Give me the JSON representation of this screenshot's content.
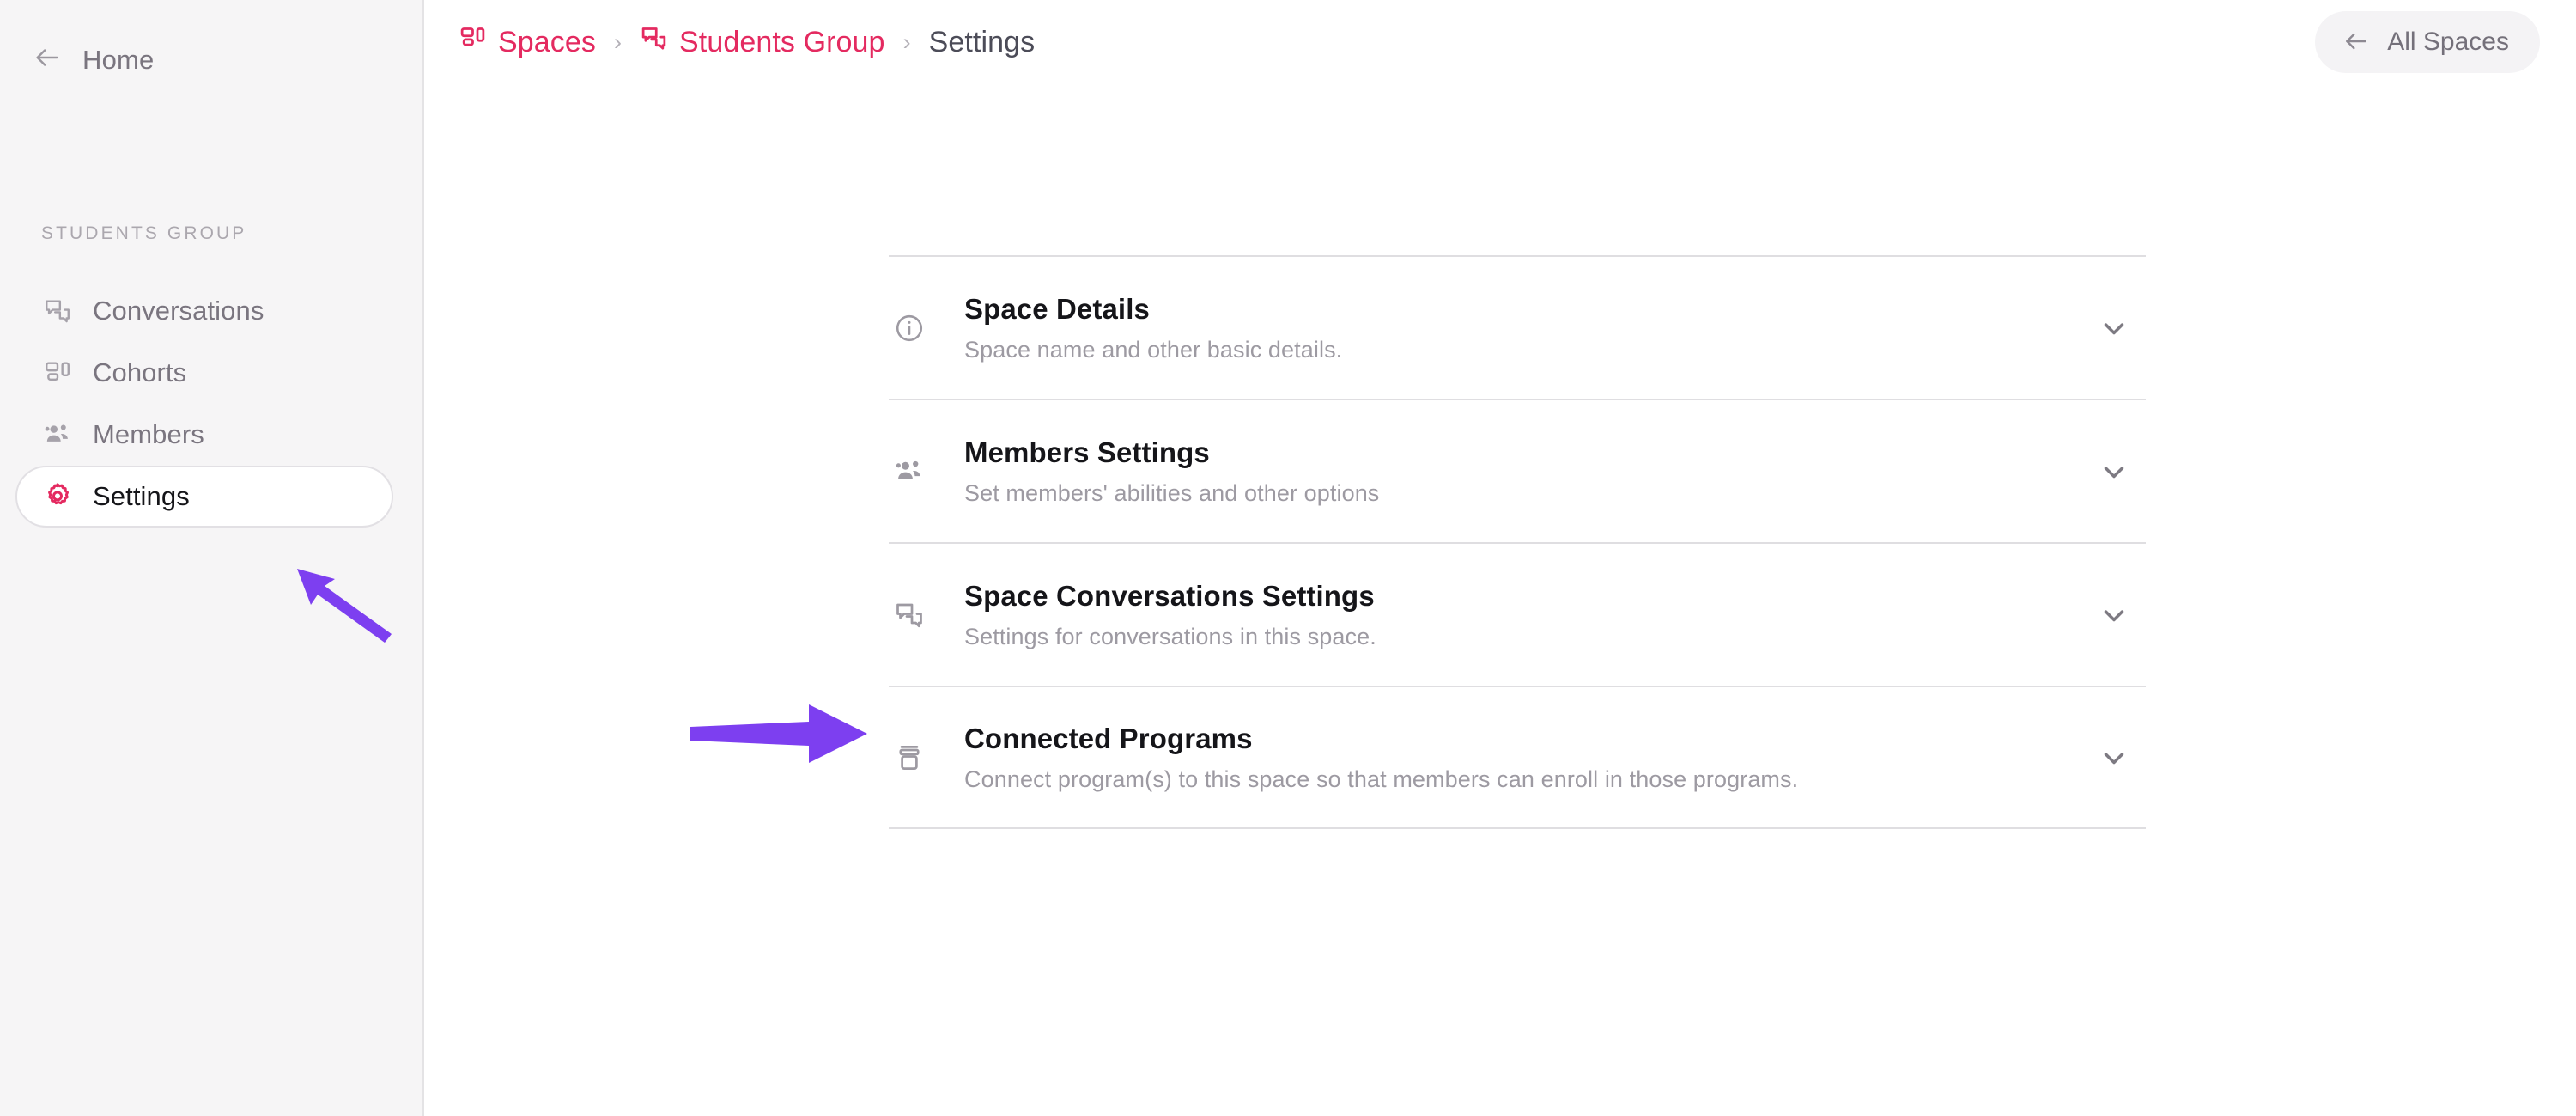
{
  "sidebar": {
    "back_link": {
      "label": "Home",
      "icon": "arrow-left-icon"
    },
    "section_title": "STUDENTS GROUP",
    "items": [
      {
        "label": "Conversations",
        "icon": "conversations-icon",
        "active": false
      },
      {
        "label": "Cohorts",
        "icon": "cohorts-icon",
        "active": false
      },
      {
        "label": "Members",
        "icon": "members-icon",
        "active": false
      },
      {
        "label": "Settings",
        "icon": "gear-icon",
        "active": true
      }
    ]
  },
  "topbar": {
    "breadcrumb": [
      {
        "label": "Spaces",
        "icon": "spaces-icon",
        "type": "link"
      },
      {
        "label": "Students Group",
        "icon": "conversations-icon",
        "type": "link"
      },
      {
        "label": "Settings",
        "icon": "",
        "type": "current"
      }
    ],
    "separator": "›",
    "all_spaces_button": {
      "label": "All Spaces",
      "icon": "arrow-left-icon"
    }
  },
  "main": {
    "rows": [
      {
        "title": "Space Details",
        "subtitle": "Space name and other basic details.",
        "icon": "info-circle-icon",
        "chevron": "chevron-down-icon"
      },
      {
        "title": "Members Settings",
        "subtitle": "Set members' abilities and other options",
        "icon": "members-icon",
        "chevron": "chevron-down-icon"
      },
      {
        "title": "Space Conversations Settings",
        "subtitle": "Settings for conversations in this space.",
        "icon": "conversations-icon",
        "chevron": "chevron-down-icon"
      },
      {
        "title": "Connected Programs",
        "subtitle": "Connect program(s) to this space so that members can enroll in those programs.",
        "icon": "archive-box-icon",
        "chevron": "chevron-down-icon"
      }
    ]
  },
  "annotations": [
    {
      "name": "arrow-pointing-to-settings",
      "direction": "up-left"
    },
    {
      "name": "arrow-pointing-to-connected-programs",
      "direction": "right"
    }
  ],
  "colors": {
    "accent_pink": "#e42a60",
    "annotation_purple": "#7d3ff0",
    "sidebar_bg": "#f6f5f6",
    "text_muted": "#9d9aa2",
    "text_dark": "#151519"
  }
}
